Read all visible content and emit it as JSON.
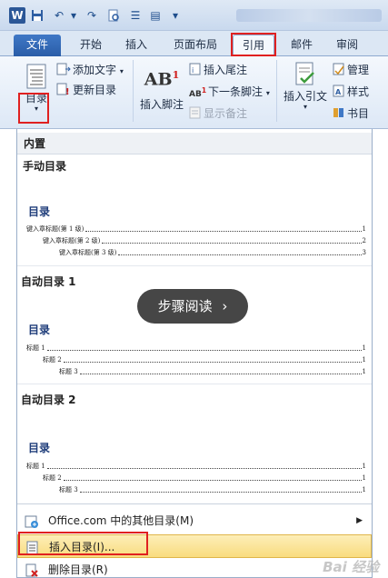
{
  "window": {
    "app_icon_letter": "W",
    "quick_access": [
      "save-icon",
      "undo-icon",
      "redo-icon",
      "print-preview-icon",
      "format-icon",
      "comment-icon"
    ]
  },
  "tabs": {
    "file": "文件",
    "home": "开始",
    "insert": "插入",
    "layout": "页面布局",
    "references": "引用",
    "mailings": "邮件",
    "review": "审阅"
  },
  "ribbon": {
    "toc_button": "目录",
    "add_text": "添加文字",
    "update_toc": "更新目录",
    "insert_footnote_icon": "AB",
    "insert_footnote_sup": "1",
    "insert_footnote": "插入脚注",
    "insert_endnote": "插入尾注",
    "next_footnote": "下一条脚注",
    "show_notes": "显示备注",
    "insert_citation": "插入引文",
    "manage_sources": "管理",
    "style": "样式",
    "bibliography": "书目"
  },
  "gallery": {
    "builtin_header": "内置",
    "manual": {
      "title": "手动目录",
      "heading": "目录",
      "lines": [
        {
          "label": "键入章标题(第 1 级)",
          "page": "1"
        },
        {
          "label": "键入章标题(第 2 级)",
          "page": "2"
        },
        {
          "label": "键入章标题(第 3 级)",
          "page": "3"
        }
      ]
    },
    "auto1": {
      "title": "自动目录 1",
      "heading": "目录",
      "lines": [
        {
          "label": "标题 1",
          "page": "1"
        },
        {
          "label": "标题 2",
          "page": "1"
        },
        {
          "label": "标题 3",
          "page": "1"
        }
      ]
    },
    "auto2": {
      "title": "自动目录 2",
      "heading": "目录",
      "lines": [
        {
          "label": "标题 1",
          "page": "1"
        },
        {
          "label": "标题 2",
          "page": "1"
        },
        {
          "label": "标题 3",
          "page": "1"
        }
      ]
    }
  },
  "menu": {
    "more_toc": "Office.com 中的其他目录(M)",
    "insert_toc": "插入目录(I)...",
    "delete_toc": "删除目录(R)"
  },
  "overlay": {
    "step_reading": "步骤阅读",
    "watermark": "Bai 经验"
  },
  "colors": {
    "highlight_box": "#e02020",
    "file_tab": "#2a5da8",
    "menu_highlight": "#f9dc7e",
    "toc_heading": "#1f3d7a"
  }
}
